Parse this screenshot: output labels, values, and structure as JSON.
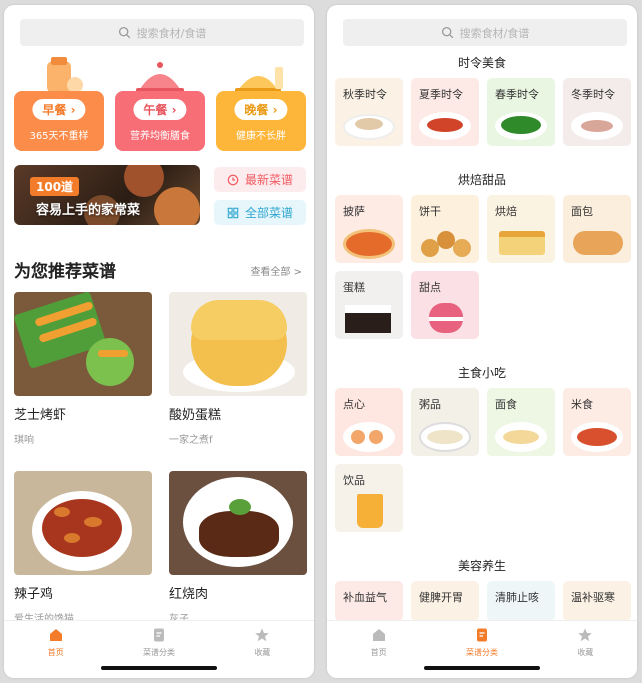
{
  "left": {
    "search": {
      "placeholder": "搜索食材/食谱"
    },
    "meals": [
      {
        "label": "早餐",
        "sub": "365天不重样",
        "color": "#fb8c4a",
        "text_color": "#f37c2b"
      },
      {
        "label": "午餐",
        "sub": "营养均衡膳食",
        "color": "#f76e76",
        "text_color": "#e9555e"
      },
      {
        "label": "晚餐",
        "sub": "健康不长胖",
        "color": "#fdb63a",
        "text_color": "#e99a16"
      }
    ],
    "banner": {
      "badge": "100道",
      "text": "容易上手的家常菜"
    },
    "quick_links": [
      {
        "label": "最新菜谱",
        "icon": "clock-icon",
        "bg": "#fdecee",
        "color": "#f05b62"
      },
      {
        "label": "全部菜谱",
        "icon": "grid-icon",
        "bg": "#e6f6fb",
        "color": "#2ea6cf"
      }
    ],
    "section": {
      "title": "为您推荐菜谱",
      "see_all": "查看全部 >"
    },
    "recipes": [
      {
        "name": "芝士烤虾",
        "author": "琪响"
      },
      {
        "name": "酸奶蛋糕",
        "author": "一家之煮f"
      },
      {
        "name": "辣子鸡",
        "author": "爱生活的馋猫"
      },
      {
        "name": "红烧肉",
        "author": "灰子"
      }
    ],
    "tabs": [
      {
        "label": "首页",
        "icon": "home-icon",
        "active": true
      },
      {
        "label": "菜谱分类",
        "icon": "menu-book-icon",
        "active": false
      },
      {
        "label": "收藏",
        "icon": "star-icon",
        "active": false
      }
    ]
  },
  "right": {
    "search": {
      "placeholder": "搜索食材/食谱"
    },
    "categories": [
      {
        "title": "时令美食",
        "items": [
          "秋季时令",
          "夏季时令",
          "春季时令",
          "冬季时令"
        ]
      },
      {
        "title": "烘焙甜品",
        "items": [
          "披萨",
          "饼干",
          "烘焙",
          "面包",
          "蛋糕",
          "甜点"
        ]
      },
      {
        "title": "主食小吃",
        "items": [
          "点心",
          "粥品",
          "面食",
          "米食",
          "饮品"
        ]
      },
      {
        "title": "美容养生",
        "items": [
          "补血益气",
          "健脾开胃",
          "清肺止咳",
          "温补驱寒"
        ]
      }
    ],
    "tabs": [
      {
        "label": "首页",
        "icon": "home-icon",
        "active": false
      },
      {
        "label": "菜谱分类",
        "icon": "menu-book-icon",
        "active": true
      },
      {
        "label": "收藏",
        "icon": "star-icon",
        "active": false
      }
    ]
  },
  "colors": {
    "accent": "#f37c2b",
    "inactive": "#999999"
  }
}
